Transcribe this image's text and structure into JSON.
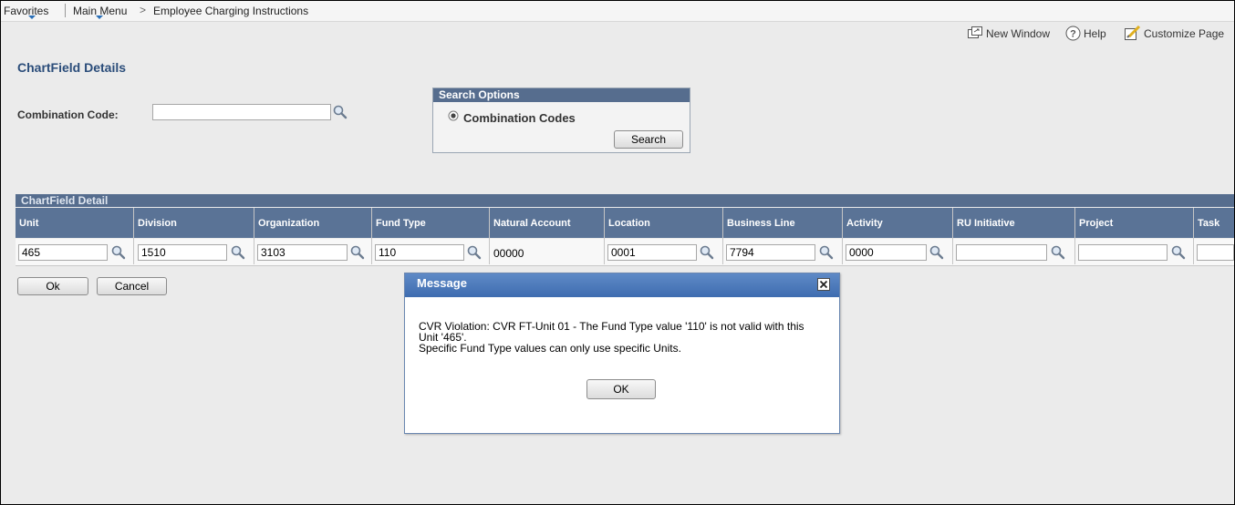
{
  "nav": {
    "favorites": "Favorites",
    "main_menu": "Main Menu",
    "separator": ">",
    "breadcrumb": "Employee Charging Instructions"
  },
  "utility": {
    "new_window": "New Window",
    "help": "Help",
    "customize": "Customize Page"
  },
  "page": {
    "title": "ChartField Details",
    "combination_code_label": "Combination Code:",
    "combination_code_value": ""
  },
  "search_options": {
    "header": "Search Options",
    "radio_label": "Combination Codes",
    "search_button": "Search"
  },
  "grid": {
    "title": "ChartField Detail",
    "columns": [
      "Unit",
      "Division",
      "Organization",
      "Fund Type",
      "Natural Account",
      "Location",
      "Business Line",
      "Activity",
      "RU Initiative",
      "Project",
      "Task"
    ],
    "values": [
      "465",
      "1510",
      "3103",
      "110",
      "00000",
      "0001",
      "7794",
      "0000",
      "",
      "",
      ""
    ]
  },
  "actions": {
    "ok": "Ok",
    "cancel": "Cancel"
  },
  "modal": {
    "title": "Message",
    "line1": "CVR Violation: CVR FT-Unit 01 - The Fund Type value '110' is not valid with this",
    "line2": "Unit '465'.",
    "line3": "Specific Fund Type values can only use specific Units.",
    "ok": "OK"
  },
  "colors": {
    "header_blue": "#566d8e",
    "modal_title_blue": "#4a78bb",
    "title_text": "#2b4d7a"
  }
}
